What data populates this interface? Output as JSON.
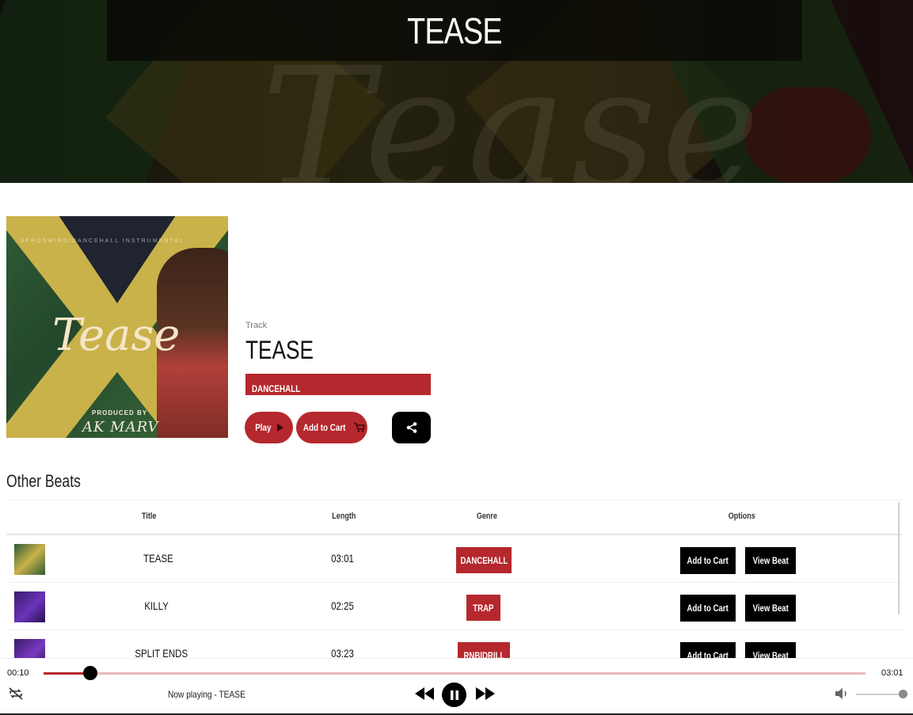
{
  "hero": {
    "title": "TEASE",
    "background_script": "Tease"
  },
  "cover": {
    "top_text": "AFROSWING/DANCEHALL INSTRUMENTAL",
    "word": "Tease",
    "produced_by": "PRODUCED BY",
    "producer": "AK MARV"
  },
  "track": {
    "label": "Track",
    "title": "TEASE",
    "genre": "DANCEHALL",
    "play_label": "Play",
    "add_to_cart_label": "Add to Cart"
  },
  "other_beats": {
    "title": "Other Beats",
    "columns": {
      "title": "Title",
      "length": "Length",
      "genre": "Genre",
      "options": "Options"
    },
    "rows": [
      {
        "title": "TEASE",
        "length": "03:01",
        "genre": "DANCEHALL",
        "add_label": "Add to Cart",
        "view_label": "View Beat"
      },
      {
        "title": "KILLY",
        "length": "02:25",
        "genre": "TRAP",
        "add_label": "Add to Cart",
        "view_label": "View Beat"
      },
      {
        "title": "SPLIT ENDS",
        "length": "03:23",
        "genre": "RNB|DRILL",
        "add_label": "Add to Cart",
        "view_label": "View Beat"
      }
    ]
  },
  "player": {
    "current_time": "00:10",
    "total_time": "03:01",
    "now_playing": "Now playing - TEASE",
    "progress": 0.057,
    "volume": 1.0
  },
  "colors": {
    "accent": "#b5282d",
    "track_bg": "#e8b9bb",
    "dark": "#000000"
  },
  "icons": [
    "play-icon",
    "cart-icon",
    "share-icon",
    "repeat-off-icon",
    "rewind-icon",
    "pause-icon",
    "fast-forward-icon",
    "volume-icon"
  ]
}
